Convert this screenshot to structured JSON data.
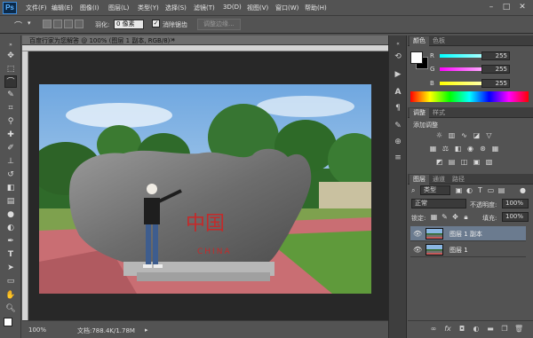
{
  "app": {
    "logo": "Ps"
  },
  "menu": [
    "文件(F)",
    "编辑(E)",
    "图像(I)",
    "图层(L)",
    "类型(Y)",
    "选择(S)",
    "滤镜(T)",
    "3D(D)",
    "视图(V)",
    "窗口(W)",
    "帮助(H)"
  ],
  "window_controls": {
    "minimize": "–",
    "maximize": "□",
    "close": "✕"
  },
  "options_bar": {
    "feather_label": "羽化:",
    "feather_value": "0 像素",
    "antialias_label": "消除锯齿",
    "refine_edge_button": "调整边缘..."
  },
  "document": {
    "tab_title": "百度行家为您解答 @ 100% (图层 1 副本, RGB/8) *",
    "close": "×",
    "zoom": "100%",
    "doc_info": "文档:788.4K/1.78M"
  },
  "photo": {
    "carved_text": "中国",
    "carved_sub": "CHINA"
  },
  "color_panel": {
    "tabs": [
      "颜色",
      "色板"
    ],
    "channels": [
      {
        "label": "R",
        "value": "255"
      },
      {
        "label": "G",
        "value": "255"
      },
      {
        "label": "B",
        "value": "255"
      }
    ],
    "foreground": "#ffffff",
    "background": "#000000"
  },
  "adjustments_panel": {
    "tabs": [
      "调整",
      "样式"
    ],
    "title": "添加调整"
  },
  "layers_panel": {
    "tabs": [
      "图层",
      "通道",
      "路径"
    ],
    "filter": "类型",
    "blend_mode": "正常",
    "opacity_label": "不透明度:",
    "opacity_value": "100%",
    "lock_label": "锁定:",
    "fill_label": "填充:",
    "fill_value": "100%",
    "layers": [
      {
        "name": "图层 1 副本",
        "selected": true
      },
      {
        "name": "图层 1",
        "selected": false
      }
    ],
    "bottom_icons": [
      "link-icon",
      "fx-icon",
      "mask-icon",
      "adjustment-icon",
      "folder-icon",
      "new-layer-icon",
      "trash-icon"
    ]
  }
}
